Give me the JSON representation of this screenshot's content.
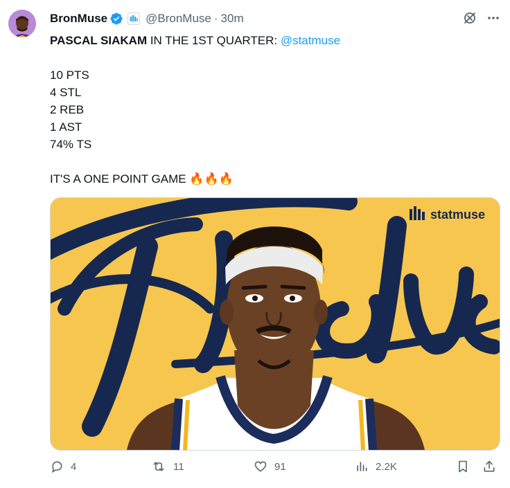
{
  "author": {
    "name": "BronMuse",
    "handle": "@BronMuse",
    "separator": "·",
    "time": "30m"
  },
  "tweet": {
    "headline_bold": "PASCAL SIAKAM",
    "headline_rest": " IN THE 1ST QUARTER: ",
    "mention": "@statmuse",
    "stats": [
      "10 PTS",
      "4 STL",
      "2 REB",
      "1 AST",
      "74% TS"
    ],
    "closing": "IT'S A ONE POINT GAME ",
    "emoji": "🔥🔥🔥"
  },
  "media": {
    "brand_text": "statmuse",
    "word": "Finals",
    "colors": {
      "background": "#f6c64f",
      "script": "#16284f",
      "headband": "#ececec",
      "skin": "#6b4126",
      "jersey": "#ffffff",
      "trim_blue": "#1b2d5c",
      "trim_yellow": "#f3b81f"
    }
  },
  "actions": {
    "replies": "4",
    "retweets": "11",
    "likes": "91",
    "views": "2.2K"
  },
  "colors": {
    "accent": "#1d9bf0",
    "muted": "#536471",
    "text": "#0f1419"
  },
  "icons": {
    "verified": "verified-badge-icon",
    "affiliate": "statmuse-affiliate-icon",
    "grok": "grok-icon",
    "more": "more-icon",
    "reply": "reply-icon",
    "retweet": "retweet-icon",
    "like": "heart-icon",
    "views": "views-icon",
    "bookmark": "bookmark-icon",
    "share": "share-icon"
  }
}
